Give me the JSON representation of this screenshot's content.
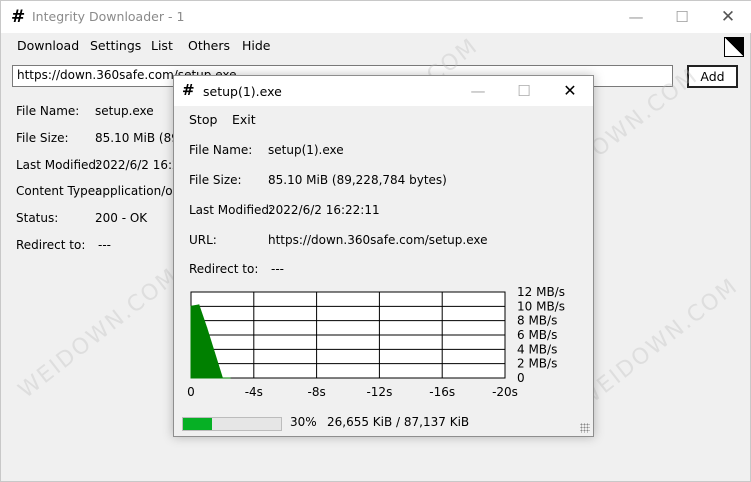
{
  "window": {
    "title": "Integrity Downloader - 1",
    "app_icon": "#"
  },
  "menu": {
    "items": [
      "Download",
      "Settings",
      "List",
      "Others",
      "Hide"
    ]
  },
  "url_bar": {
    "value": "https://down.360safe.com/setup.exe"
  },
  "add_button": {
    "label": "Add"
  },
  "details": [
    {
      "label": "File Name:",
      "value": "setup.exe"
    },
    {
      "label": "File Size:",
      "value": "85.10 MiB (89,2"
    },
    {
      "label": "Last Modified:",
      "value": "2022/6/2 16:22:"
    },
    {
      "label": "Content Type:",
      "value": "application/oc"
    },
    {
      "label": "Status:",
      "value": "200 - OK"
    },
    {
      "label": "Redirect to:",
      "value": "---"
    }
  ],
  "watermark": "WEIDOWN.COM",
  "popup": {
    "title": "setup(1).exe",
    "icon": "#",
    "menu": [
      "Stop",
      "Exit"
    ],
    "fields": [
      {
        "label": "File Name:",
        "value": "setup(1).exe"
      },
      {
        "label": "File Size:",
        "value": "85.10 MiB (89,228,784 bytes)"
      },
      {
        "label": "Last Modified:",
        "value": "2022/6/2 16:22:11"
      },
      {
        "label": "URL:",
        "value": "https://down.360safe.com/setup.exe"
      },
      {
        "label": "Redirect to:",
        "value": "---"
      }
    ],
    "progress": {
      "percent": 30,
      "percent_text": "30%",
      "bytes_text": "26,655 KiB / 87,137 KiB"
    }
  },
  "chart_data": {
    "type": "area",
    "x": [
      0,
      -0.5,
      -1,
      -1.5,
      -2,
      -2.5
    ],
    "values": [
      10.0,
      10.2,
      7.0,
      3.5,
      0,
      0
    ],
    "ylim": [
      0,
      12
    ],
    "xlim": [
      0,
      -20
    ],
    "y_ticks": [
      "12 MB/s",
      "10 MB/s",
      "8 MB/s",
      "6 MB/s",
      "4 MB/s",
      "2 MB/s",
      "0"
    ],
    "x_ticks": [
      "0",
      "-4s",
      "-8s",
      "-12s",
      "-16s",
      "-20s"
    ],
    "grid": true,
    "fill_color": "#008000"
  }
}
